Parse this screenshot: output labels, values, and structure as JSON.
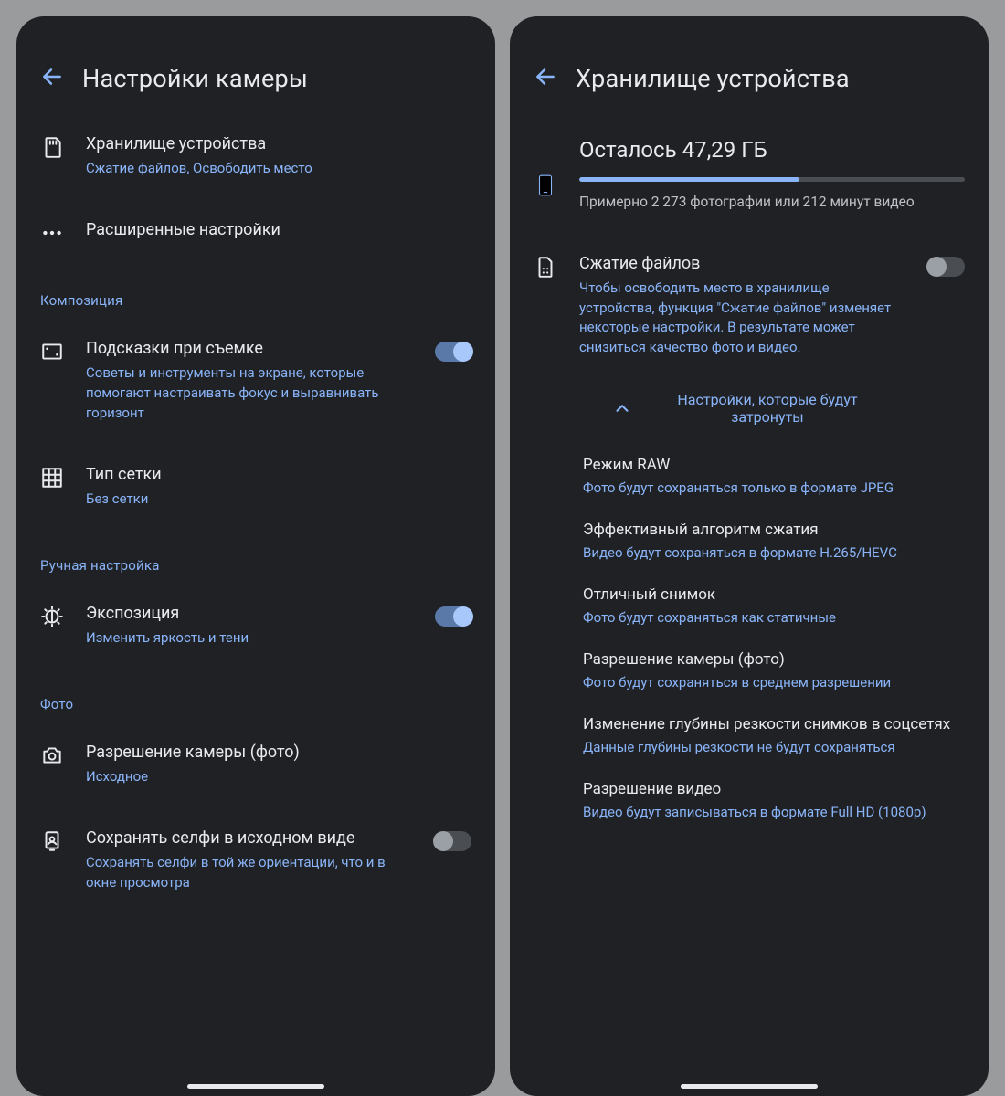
{
  "left": {
    "title": "Настройки камеры",
    "items": {
      "storage": {
        "title": "Хранилище устройства",
        "sub": "Сжатие файлов, Освободить место"
      },
      "advanced": {
        "title": "Расширенные настройки"
      }
    },
    "section_composition": "Композиция",
    "items2": {
      "hints": {
        "title": "Подсказки при съемке",
        "sub": "Советы и инструменты на экране, которые помогают настраивать фокус и выравнивать горизонт"
      },
      "grid": {
        "title": "Тип сетки",
        "sub": "Без сетки"
      }
    },
    "section_manual": "Ручная настройка",
    "items3": {
      "exposure": {
        "title": "Экспозиция",
        "sub": "Изменить яркость и тени"
      }
    },
    "section_photo": "Фото",
    "items4": {
      "resolution": {
        "title": "Разрешение камеры (фото)",
        "sub": "Исходное"
      },
      "selfie": {
        "title": "Сохранять селфи в исходном виде",
        "sub": "Сохранять селфи в той же ориентации, что и в окне просмотра"
      }
    }
  },
  "right": {
    "title": "Хранилище устройства",
    "storage": {
      "heading": "Осталось 47,29 ГБ",
      "estimate": "Примерно 2 273 фотографии или 212 минут видео",
      "progress_pct": 57
    },
    "compress": {
      "title": "Сжатие файлов",
      "sub": "Чтобы освободить место в хранилище устройства, функция \"Сжатие файлов\" изменяет некоторые настройки. В результате может снизиться качество фото и видео."
    },
    "expander_label": "Настройки, которые будут затронуты",
    "affected": [
      {
        "title": "Режим RAW",
        "sub": "Фото будут сохраняться только в формате JPEG"
      },
      {
        "title": "Эффективный алгоритм сжатия",
        "sub": "Видео будут сохраняться в формате H.265/HEVC"
      },
      {
        "title": "Отличный снимок",
        "sub": "Фото будут сохраняться как статичные"
      },
      {
        "title": "Разрешение камеры (фото)",
        "sub": "Фото будут сохраняться в среднем разрешении"
      },
      {
        "title": "Изменение глубины резкости снимков в соцсетях",
        "sub": "Данные глубины резкости не будут сохраняться"
      },
      {
        "title": "Разрешение видео",
        "sub": "Видео будут записываться в формате Full HD (1080p)"
      }
    ]
  }
}
